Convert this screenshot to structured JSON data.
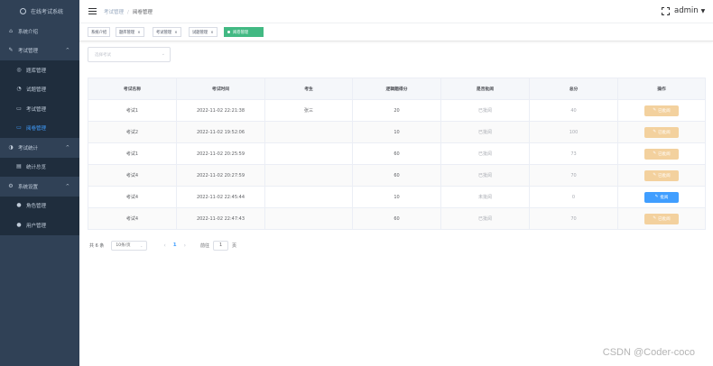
{
  "sidebar": {
    "title": "在线考试系统",
    "items": [
      {
        "label": "系统介绍",
        "icon": "home-icon",
        "level": 1
      },
      {
        "label": "考试管理",
        "icon": "exam-icon",
        "level": 1,
        "caret": "^"
      },
      {
        "label": "题库管理",
        "icon": "question-bank-icon",
        "level": 2
      },
      {
        "label": "试题管理",
        "icon": "question-icon",
        "level": 2
      },
      {
        "label": "考试管理",
        "icon": "exam-manage-icon",
        "level": 2
      },
      {
        "label": "阅卷管理",
        "icon": "marking-icon",
        "level": 2,
        "active": true
      },
      {
        "label": "考试统计",
        "icon": "stats-icon",
        "level": 1,
        "caret": "^"
      },
      {
        "label": "统计总览",
        "icon": "overview-icon",
        "level": 2
      },
      {
        "label": "系统设置",
        "icon": "settings-icon",
        "level": 1,
        "caret": "^"
      },
      {
        "label": "角色管理",
        "icon": "role-icon",
        "level": 2
      },
      {
        "label": "用户管理",
        "icon": "user-icon",
        "level": 2
      }
    ]
  },
  "header": {
    "breadcrumb": [
      "考试管理",
      "阅卷管理"
    ],
    "separator": "/",
    "user": "admin",
    "dropdown_icon": "caret-down-icon"
  },
  "tags": [
    {
      "label": "系统介绍",
      "close": ""
    },
    {
      "label": "题库管理",
      "close": "×"
    },
    {
      "label": "考试管理",
      "close": "×"
    },
    {
      "label": "试题管理",
      "close": "×"
    },
    {
      "label": "阅卷管理",
      "close": "×",
      "active": true
    }
  ],
  "filter": {
    "placeholder": "选择考试"
  },
  "table": {
    "headers": [
      "考试名称",
      "考试时间",
      "考生",
      "逻辑题得分",
      "是否批阅",
      "总分",
      "操作"
    ],
    "rows": [
      {
        "cells": [
          "考试1",
          "2022-11-02 22:21:38",
          "张三",
          "20",
          "已批阅",
          "40"
        ],
        "action": "已批阅",
        "action_state": "disabled"
      },
      {
        "cells": [
          "考试2",
          "2022-11-02 19:52:06",
          "",
          "10",
          "已批阅",
          "100"
        ],
        "action": "已批阅",
        "action_state": "disabled"
      },
      {
        "cells": [
          "考试1",
          "2022-11-02 20:25:59",
          "",
          "60",
          "已批阅",
          "73"
        ],
        "action": "已批阅",
        "action_state": "disabled"
      },
      {
        "cells": [
          "考试4",
          "2022-11-02 20:27:59",
          "",
          "60",
          "已批阅",
          "70"
        ],
        "action": "已批阅",
        "action_state": "disabled"
      },
      {
        "cells": [
          "考试4",
          "2022-11-02 22:45:44",
          "",
          "10",
          "未批阅",
          "0"
        ],
        "action": "批阅",
        "action_state": "primary"
      },
      {
        "cells": [
          "考试4",
          "2022-11-02 22:47:43",
          "",
          "60",
          "已批阅",
          "70"
        ],
        "action": "已批阅",
        "action_state": "disabled"
      }
    ]
  },
  "pagination": {
    "total": "共 6 条",
    "page_size": "10条/页",
    "prev": "‹",
    "current": "1",
    "next": "›",
    "goto": "前往",
    "jump_value": "1",
    "page_unit": "页"
  },
  "watermark": "CSDN @Coder-coco",
  "colors": {
    "sidebar": "#304156",
    "active": "#409eff",
    "tag_active": "#42b983",
    "disabled_btn": "#f3d19e"
  }
}
